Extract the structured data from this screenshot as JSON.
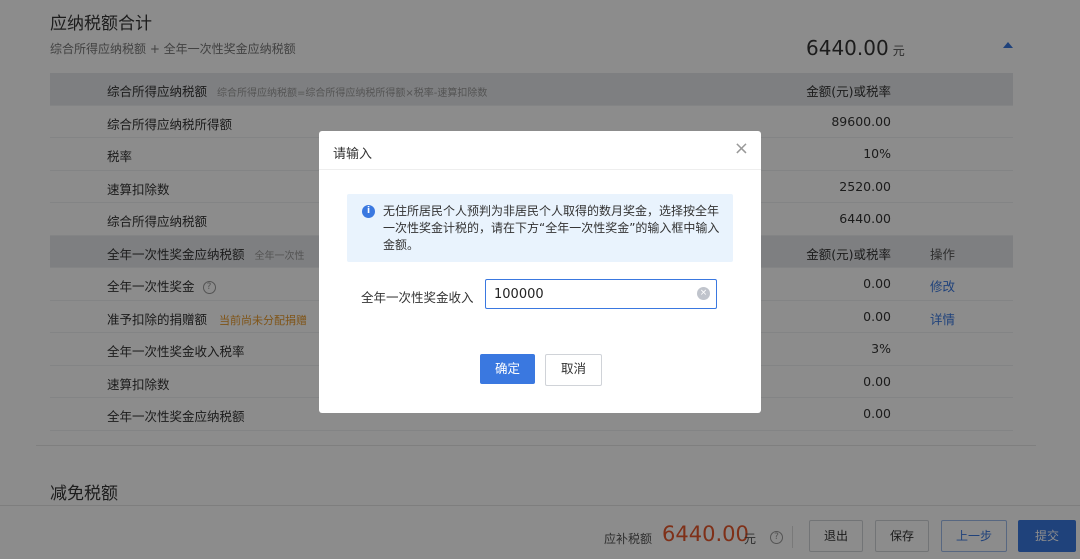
{
  "payable": {
    "title": "应纳税额合计",
    "formula": "综合所得应纳税额 + 全年一次性奖金应纳税额",
    "total": "6440.00",
    "unit": "元"
  },
  "table": {
    "comp_header": {
      "name": "综合所得应纳税额",
      "hint": "综合所得应纳税额=综合所得应纳税所得额×税率-速算扣除数",
      "col": "金额(元)或税率"
    },
    "comp_rows": [
      {
        "name": "综合所得应纳税所得额",
        "value": "89600.00"
      },
      {
        "name": "税率",
        "value": "10%"
      },
      {
        "name": "速算扣除数",
        "value": "2520.00"
      },
      {
        "name": "综合所得应纳税额",
        "value": "6440.00"
      }
    ],
    "bonus_header": {
      "name": "全年一次性奖金应纳税额",
      "hint": "全年一次性",
      "col": "金额(元)或税率",
      "op": "操作"
    },
    "bonus_rows": [
      {
        "name": "全年一次性奖金",
        "value": "0.00",
        "op": "修改"
      },
      {
        "name": "准予扣除的捐赠额",
        "warn": "当前尚未分配捐赠",
        "value": "0.00",
        "op": "详情"
      },
      {
        "name": "全年一次性奖金收入税率",
        "value": "3%"
      },
      {
        "name": "速算扣除数",
        "value": "0.00"
      },
      {
        "name": "全年一次性奖金应纳税额",
        "value": "0.00"
      }
    ],
    "question_glyph": "?"
  },
  "relief": {
    "title": "减免税额"
  },
  "footer": {
    "label": "应补税额",
    "amount": "6440.00",
    "unit": "元",
    "question_glyph": "?",
    "exit": "退出",
    "save": "保存",
    "prev": "上一步",
    "submit": "提交"
  },
  "modal": {
    "title": "请输入",
    "close_glyph": "×",
    "info_glyph": "i",
    "notice": "无住所居民个人预判为非居民个人取得的数月奖金，选择按全年一次性奖金计税的，请在下方“全年一次性奖金”的输入框中输入金额。",
    "field_label": "全年一次性奖金收入",
    "field_value": "100000",
    "clear_glyph": "×",
    "ok": "确定",
    "cancel": "取消"
  }
}
